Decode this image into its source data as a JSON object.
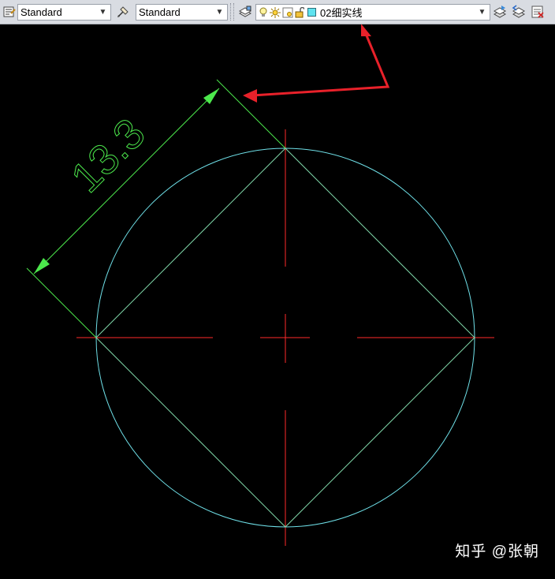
{
  "toolbar": {
    "text_style": "Standard",
    "dim_style": "Standard",
    "layer_name": "02细实线"
  },
  "drawing": {
    "dimension_text": "13.3"
  },
  "colors": {
    "geometry": "#6fe0e8",
    "centerline": "#ff2a2a",
    "dimension": "#4ce84c",
    "annotation_arrow": "#e8212a"
  },
  "watermark": "知乎 @张朝"
}
